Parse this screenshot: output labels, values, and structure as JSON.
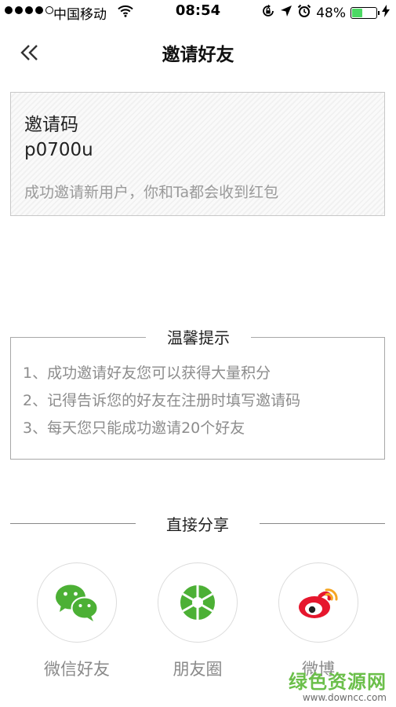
{
  "status_bar": {
    "carrier": "中国移动",
    "time": "08:54",
    "battery_percent": "48%",
    "battery_level": 0.48
  },
  "nav": {
    "title": "邀请好友"
  },
  "invite": {
    "label": "邀请码",
    "code": "p0700u",
    "description": "成功邀请新用户，你和Ta都会收到红包"
  },
  "tips": {
    "title": "温馨提示",
    "items": [
      "1、成功邀请好友您可以获得大量积分",
      "2、记得告诉您的好友在注册时填写邀请码",
      "3、每天您只能成功邀请20个好友"
    ]
  },
  "share": {
    "title": "直接分享",
    "targets": [
      {
        "label": "微信好友",
        "icon": "wechat-icon",
        "color": "#4cb035"
      },
      {
        "label": "朋友圈",
        "icon": "moments-icon",
        "color": "#4cb035"
      },
      {
        "label": "微博",
        "icon": "weibo-icon",
        "color": "#e6162d"
      }
    ]
  },
  "watermark": {
    "logo": "绿色资源网",
    "url": "www.downcc.com"
  }
}
